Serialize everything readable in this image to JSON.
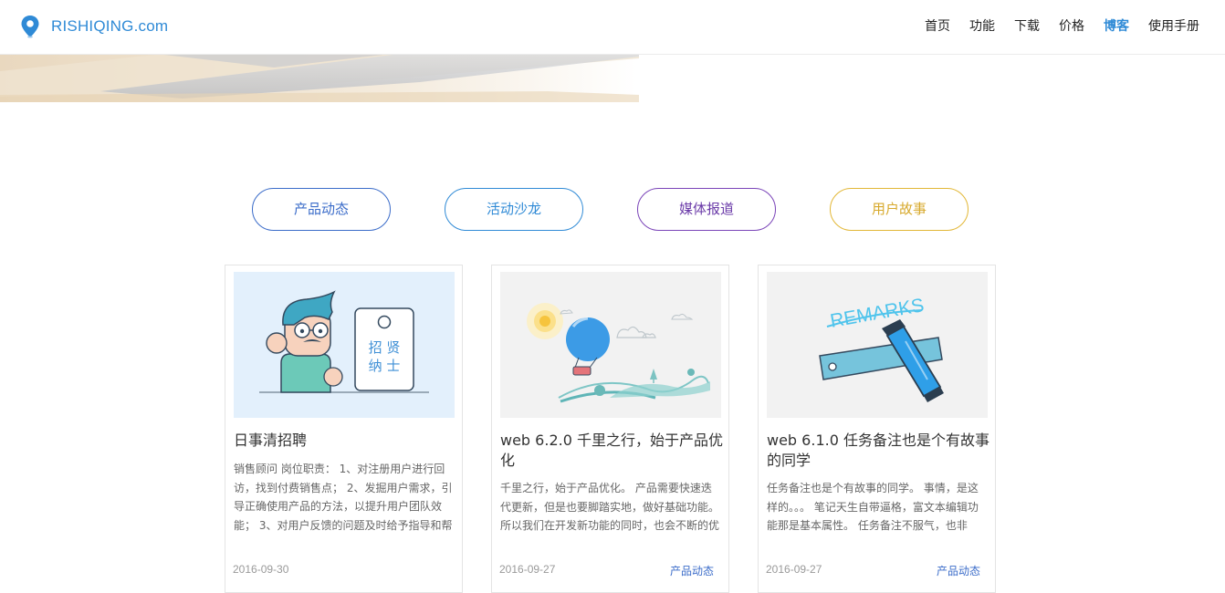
{
  "header": {
    "logo_text": "RISHIQING.com",
    "nav": [
      {
        "label": "首页",
        "active": false
      },
      {
        "label": "功能",
        "active": false
      },
      {
        "label": "下载",
        "active": false
      },
      {
        "label": "价格",
        "active": false
      },
      {
        "label": "博客",
        "active": true
      },
      {
        "label": "使用手册",
        "active": false
      }
    ]
  },
  "categories": [
    {
      "label": "产品动态",
      "color": "#3b6cc9"
    },
    {
      "label": "活动沙龙",
      "color": "#2f8ad6"
    },
    {
      "label": "媒体报道",
      "color": "#6a3aa8"
    },
    {
      "label": "用户故事",
      "color": "#d7a92c"
    }
  ],
  "cards": [
    {
      "title": "日事清招聘",
      "excerpt": "销售顾问 岗位职责： 1、对注册用户进行回访，找到付费销售点； 2、发掘用户需求，引导正确使用产品的方法，以提升用户团队效能； 3、对用户反馈的问题及时给予指导和帮",
      "date": "2016-09-30",
      "category": "",
      "image_text": "招 贤 纳 士",
      "image_line1": "招 贤",
      "image_line2": "纳 士"
    },
    {
      "title": "web 6.2.0 千里之行，始于产品优化",
      "excerpt": "千里之行，始于产品优化。 产品需要快速迭代更新，但是也要脚踏实地，做好基础功能。 所以我们在开发新功能的同时，也会不断的优",
      "date": "2016-09-27",
      "category": "产品动态"
    },
    {
      "title": "web 6.1.0 任务备注也是个有故事的同学",
      "excerpt": "任务备注也是个有故事的同学。 事情，是这样的。。。 笔记天生自带逼格，富文本编辑功能那是基本属性。 任务备注不服气，也非",
      "date": "2016-09-27",
      "category": "产品动态",
      "image_text": "REMARKS"
    }
  ],
  "colors": {
    "brand": "#2f8ad6",
    "nav_active": "#2f8ad6",
    "card_border": "#e4e4e4"
  }
}
